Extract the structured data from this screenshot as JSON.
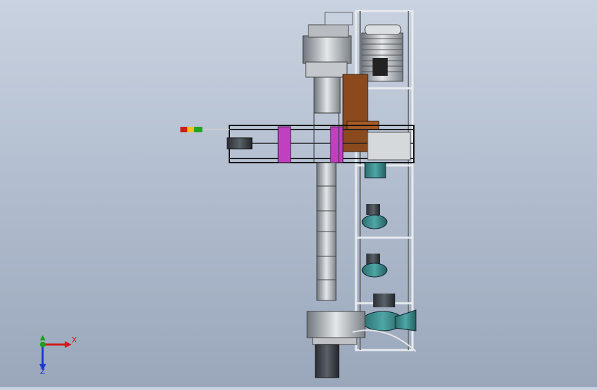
{
  "viewport": {
    "background_top": "#c9d2e0",
    "background_bottom": "#9aa7bb"
  },
  "triad": {
    "x_label": "X",
    "y_label": "Y",
    "z_label": "Z",
    "x_color": "#d11a1a",
    "y_color": "#17a317",
    "z_color": "#1a3bd1"
  },
  "model": {
    "motor_label": "",
    "frame_color": "#9aa0a8",
    "pump_color": "#3a8a8a",
    "accent_color": "#c040c0",
    "plate_color": "#8b4a1e"
  },
  "icons": [
    "coordinate-triad-icon"
  ]
}
